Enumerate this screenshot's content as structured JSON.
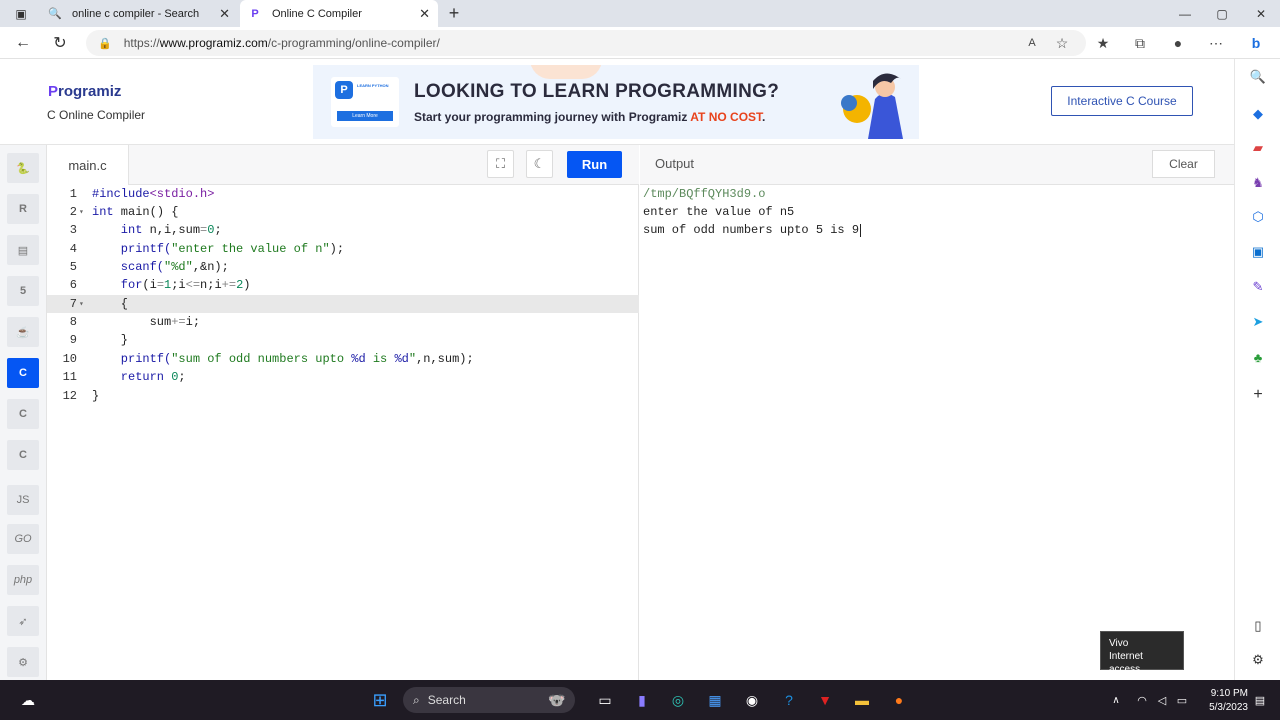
{
  "browser": {
    "tabs": [
      {
        "title": "online c compiler - Search",
        "icon": "search-icon"
      },
      {
        "title": "Online C Compiler",
        "icon": "programiz-favicon"
      }
    ],
    "url_prefix": "https://",
    "url_domain": "www.programiz.com",
    "url_path": "/c-programming/online-compiler/"
  },
  "header": {
    "logo": "rogramiz",
    "logo_letter": "P",
    "subtitle": "C Online Compiler",
    "banner": {
      "badge_top": "LEARN PYTHON",
      "badge_button": "Learn More",
      "headline": "LOOKING TO LEARN PROGRAMMING?",
      "subline": "Start your programming journey with Programiz ",
      "subline_highlight": "AT NO COST",
      "subline_end": "."
    },
    "course_button": "Interactive C Course"
  },
  "languages": [
    "python",
    "R",
    "sql",
    "html",
    "java",
    "c",
    "c++",
    "c#",
    "JS",
    "GO",
    "php",
    "swift",
    "rust"
  ],
  "languages_labels": {
    "js": "JS",
    "go": "GO",
    "php": "php"
  },
  "editor": {
    "filename": "main.c",
    "run_label": "Run",
    "lines": [
      {
        "n": "1",
        "fold": ""
      },
      {
        "n": "2",
        "fold": "▾"
      },
      {
        "n": "3",
        "fold": ""
      },
      {
        "n": "4",
        "fold": ""
      },
      {
        "n": "5",
        "fold": ""
      },
      {
        "n": "6",
        "fold": ""
      },
      {
        "n": "7",
        "fold": "▾"
      },
      {
        "n": "8",
        "fold": ""
      },
      {
        "n": "9",
        "fold": ""
      },
      {
        "n": "10",
        "fold": ""
      },
      {
        "n": "11",
        "fold": ""
      },
      {
        "n": "12",
        "fold": ""
      }
    ],
    "code": {
      "l1a": "#include",
      "l1b": "<stdio.h>",
      "l2a": "int",
      "l2b": " main() {",
      "l3a": "    int",
      "l3b": " n,i,sum",
      "l3c": "=",
      "l3d": "0",
      "l3e": ";",
      "l4a": "    printf(",
      "l4b": "\"enter the value of n\"",
      "l4c": ");",
      "l5a": "    scanf(",
      "l5b": "\"%d\"",
      "l5c": ",&n);",
      "l6a": "    for",
      "l6b": "(i",
      "l6c": "=",
      "l6d": "1",
      "l6e": ";i",
      "l6f": "<=",
      "l6g": "n;i",
      "l6h": "+=",
      "l6i": "2",
      "l6j": ")",
      "l7": "    {",
      "l8a": "        sum",
      "l8b": "+=",
      "l8c": "i;",
      "l9": "    }",
      "l10a": "    printf(",
      "l10b": "\"sum of odd numbers upto ",
      "l10c": "%d",
      "l10d": " is ",
      "l10e": "%d",
      "l10f": "\"",
      "l10g": ",n,sum);",
      "l11a": "    return",
      "l11b": " 0",
      "l11c": ";",
      "l12": "}"
    }
  },
  "output": {
    "title": "Output",
    "clear_label": "Clear",
    "lines": [
      "/tmp/BQffQYH3d9.o",
      "enter the value of n5",
      "sum of odd numbers upto 5 is 9"
    ]
  },
  "toast": {
    "line1": "Vivo",
    "line2": "Internet access"
  },
  "taskbar": {
    "search_label": "Search",
    "time": "9:10 PM",
    "date": "5/3/2023"
  }
}
